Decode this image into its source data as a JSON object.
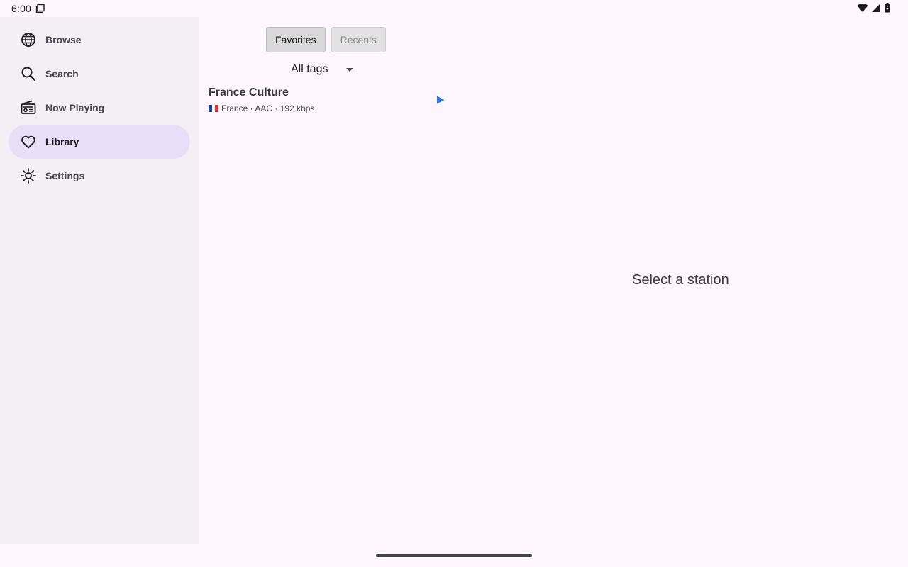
{
  "status": {
    "time": "6:00"
  },
  "nav": {
    "items": [
      {
        "label": "Browse",
        "icon": "globe-icon"
      },
      {
        "label": "Search",
        "icon": "search-icon"
      },
      {
        "label": "Now Playing",
        "icon": "radio-icon"
      },
      {
        "label": "Library",
        "icon": "heart-icon",
        "active": true
      },
      {
        "label": "Settings",
        "icon": "brightness-icon"
      }
    ]
  },
  "tabs": [
    {
      "label": "Favorites",
      "selected": true
    },
    {
      "label": "Recents",
      "selected": false
    }
  ],
  "filter": {
    "selected": "All tags"
  },
  "stations": [
    {
      "name": "France Culture",
      "country": "France",
      "codec": "AAC",
      "bitrate": "192 kbps",
      "meta": "France · AAC · 192 kbps"
    }
  ],
  "detail": {
    "empty_text": "Select a station"
  },
  "colors": {
    "accent": "#e8def8",
    "play": "#2a74e8",
    "drawer_bg": "#f4eff4",
    "page_bg": "#fdf7fd"
  }
}
